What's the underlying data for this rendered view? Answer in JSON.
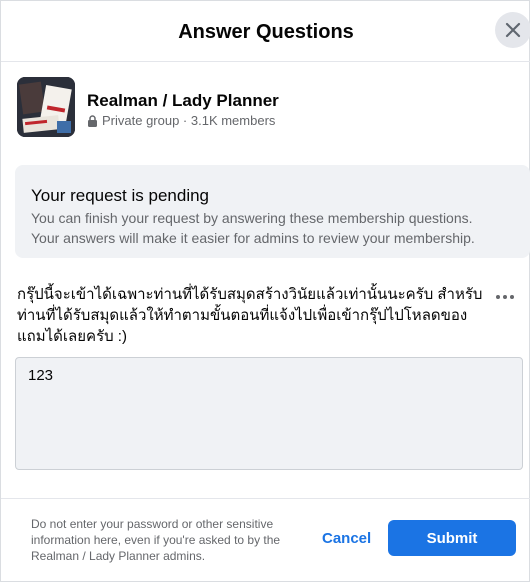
{
  "dialog": {
    "title": "Answer Questions",
    "close_icon": "close-icon"
  },
  "group": {
    "name": "Realman / Lady Planner",
    "privacy_icon": "lock-icon",
    "meta": "Private group · 3.1K members"
  },
  "pending": {
    "title": "Your request is pending",
    "description": "You can finish your request by answering these membership questions.\nYour answers will make it easier for admins to review your membership."
  },
  "question": {
    "text": "กรุ๊ปนี้จะเข้าได้เฉพาะท่านที่ได้รับสมุดสร้างวินัยแล้วเท่านั้นนะครับ สำหรับท่านที่ได้รับสมุดแล้วให้ทำตามขั้นตอนที่แจ้งไปเพื่อเข้ากรุ๊ปไปโหลดของแถมได้เลยครับ :)",
    "more_icon": "more-options-icon",
    "answer_value": "123"
  },
  "footer": {
    "disclaimer": "Do not enter your password or other sensitive information here, even if you're asked to by the Realman / Lady Planner admins.",
    "cancel_label": "Cancel",
    "submit_label": "Submit"
  },
  "colors": {
    "accent": "#1b74e4",
    "surface": "#f0f2f5",
    "secondary_text": "#65676b"
  }
}
